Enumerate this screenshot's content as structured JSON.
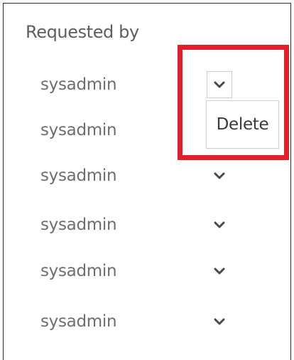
{
  "column": {
    "header": "Requested by"
  },
  "rows": [
    {
      "user": "sysadmin",
      "action_icon": "chevron-down-icon",
      "open": true
    },
    {
      "user": "sysadmin",
      "action_icon": "chevron-down-icon",
      "open": false
    },
    {
      "user": "sysadmin",
      "action_icon": "chevron-down-icon",
      "open": false
    },
    {
      "user": "sysadmin",
      "action_icon": "chevron-down-icon",
      "open": false
    },
    {
      "user": "sysadmin",
      "action_icon": "chevron-down-icon",
      "open": false
    },
    {
      "user": "sysadmin",
      "action_icon": "chevron-down-icon",
      "open": false
    }
  ],
  "dropdown": {
    "items": [
      {
        "label": "Delete"
      }
    ]
  },
  "colors": {
    "highlight": "#e01f2a",
    "chevron": "#4a4a4a",
    "text_muted": "#6e6e6e"
  }
}
